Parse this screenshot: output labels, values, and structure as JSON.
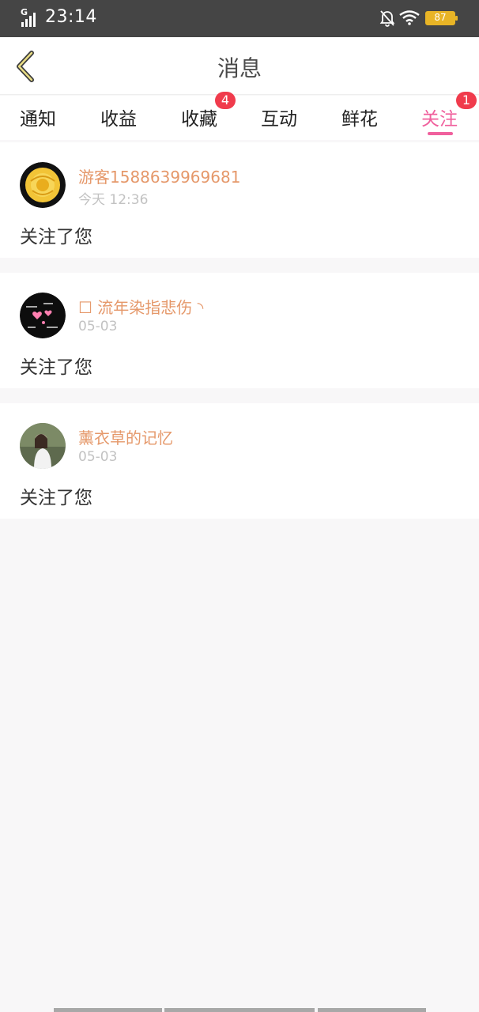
{
  "status_bar": {
    "network": "G",
    "time": "23:14",
    "battery": "87",
    "battery_color": "#e8b426"
  },
  "header": {
    "back_icon": "chevron-left-icon",
    "title": "消息"
  },
  "tabs": [
    {
      "label": "通知",
      "badge": null,
      "active": false
    },
    {
      "label": "收益",
      "badge": null,
      "active": false
    },
    {
      "label": "收藏",
      "badge": "4",
      "active": false
    },
    {
      "label": "互动",
      "badge": null,
      "active": false
    },
    {
      "label": "鲜花",
      "badge": null,
      "active": false
    },
    {
      "label": "关注",
      "badge": "1",
      "active": true
    }
  ],
  "colors": {
    "accent": "#f0609d",
    "badge": "#f03b4c",
    "username": "#e5986a"
  },
  "messages": [
    {
      "name": "游客1588639969681",
      "time": "今天 12:36",
      "text": "关注了您",
      "avatar": "yellow-rose-avatar"
    },
    {
      "name": "☐ 流年染指悲伤 ◝",
      "time": "05-03",
      "text": "关注了您",
      "avatar": "black-hearts-avatar"
    },
    {
      "name": "薰衣草的记忆",
      "time": "05-03",
      "text": "关注了您",
      "avatar": "girl-photo-avatar"
    }
  ]
}
